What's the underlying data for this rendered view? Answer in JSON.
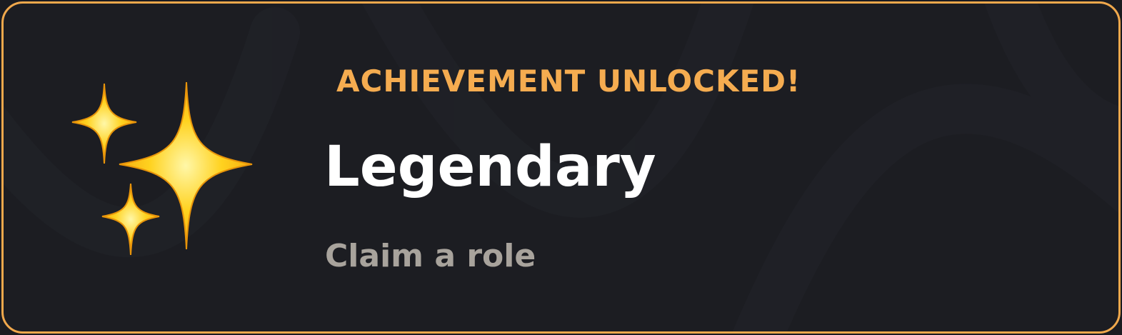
{
  "card": {
    "header": "ACHIEVEMENT UNLOCKED!",
    "achievement_name": "Legendary",
    "achievement_description": "Claim a role",
    "icon": "sparkles-icon"
  },
  "colors": {
    "border": "#f0a84c",
    "header_text": "#f5ac50",
    "name_text": "#ffffff",
    "description_text": "#a8a39c",
    "background": "#1c1d22",
    "sparkle": "#ffd21f"
  }
}
